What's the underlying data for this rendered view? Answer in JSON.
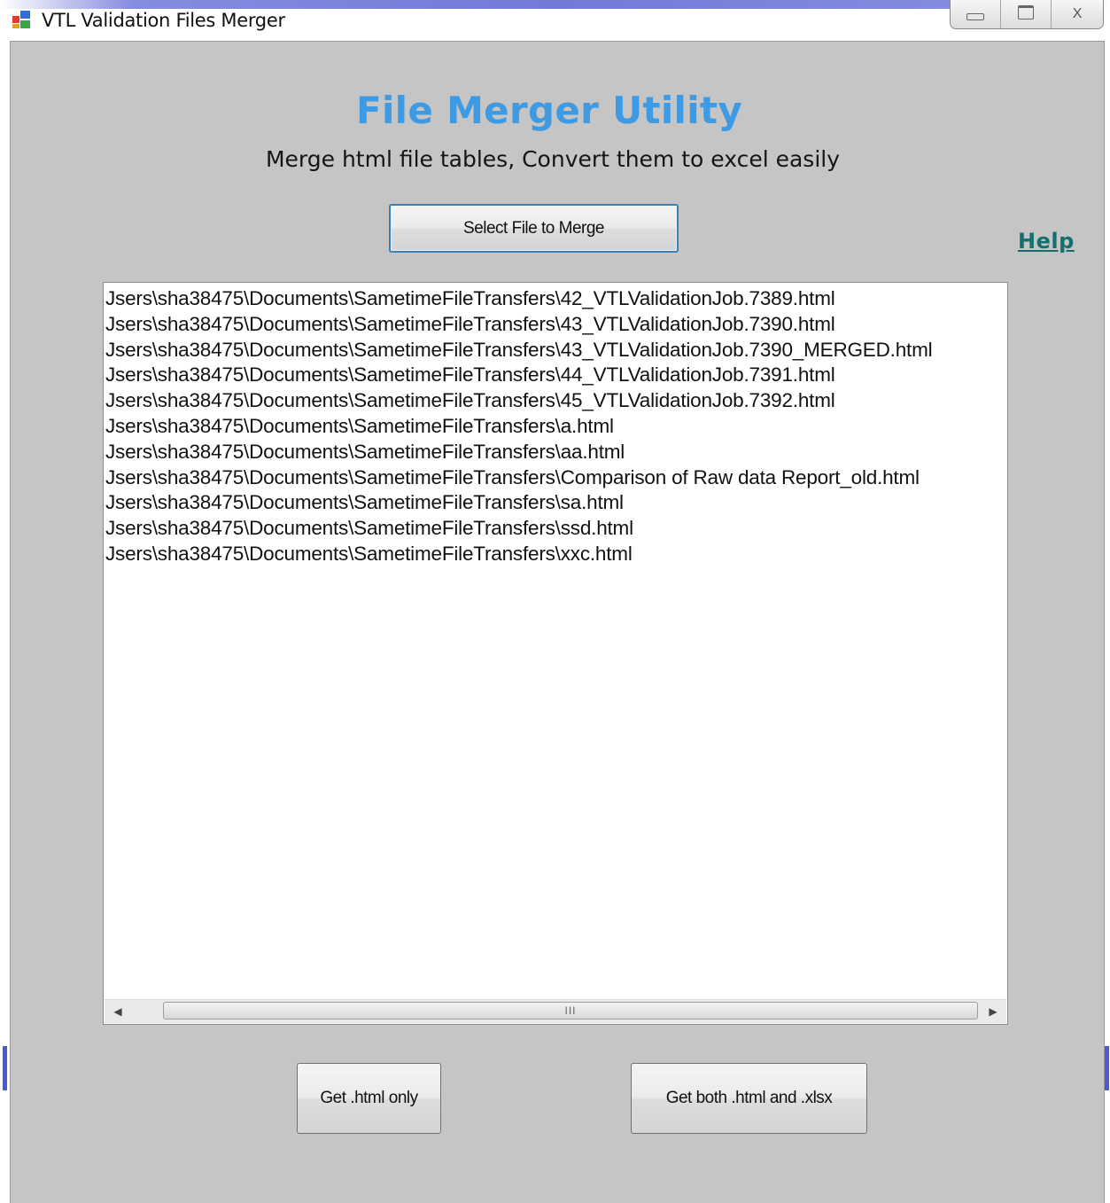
{
  "window": {
    "title": "VTL Validation Files Merger",
    "icon": "app-window-icon",
    "caption_buttons": [
      "minimize-icon",
      "restore-icon",
      "close-icon"
    ],
    "close_glyph": "X"
  },
  "header": {
    "title": "File Merger Utility",
    "subtitle": "Merge html file tables, Convert them to excel easily"
  },
  "toolbar": {
    "select_label": "Select File to Merge",
    "help_label": "Help"
  },
  "file_list": {
    "items": [
      "Jsers\\sha38475\\Documents\\SametimeFileTransfers\\42_VTLValidationJob.7389.html",
      "Jsers\\sha38475\\Documents\\SametimeFileTransfers\\43_VTLValidationJob.7390.html",
      "Jsers\\sha38475\\Documents\\SametimeFileTransfers\\43_VTLValidationJob.7390_MERGED.html",
      "Jsers\\sha38475\\Documents\\SametimeFileTransfers\\44_VTLValidationJob.7391.html",
      "Jsers\\sha38475\\Documents\\SametimeFileTransfers\\45_VTLValidationJob.7392.html",
      "Jsers\\sha38475\\Documents\\SametimeFileTransfers\\a.html",
      "Jsers\\sha38475\\Documents\\SametimeFileTransfers\\aa.html",
      "Jsers\\sha38475\\Documents\\SametimeFileTransfers\\Comparison of Raw data Report_old.html",
      "Jsers\\sha38475\\Documents\\SametimeFileTransfers\\sa.html",
      "Jsers\\sha38475\\Documents\\SametimeFileTransfers\\ssd.html",
      "Jsers\\sha38475\\Documents\\SametimeFileTransfers\\xxc.html"
    ],
    "scroll_grip": "III"
  },
  "actions": {
    "html_only_label": "Get .html only",
    "both_label": "Get both .html and .xlsx"
  },
  "colors": {
    "heading": "#3d9ae3",
    "help_link": "#13706f",
    "form_background": "#c5c5c5"
  }
}
